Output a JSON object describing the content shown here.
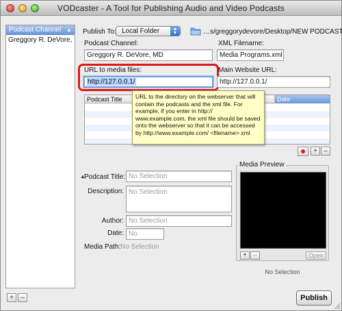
{
  "window": {
    "title": "VODcaster -  A Tool for Publishing Audio and Video Podcasts"
  },
  "sidebar": {
    "header": "Podcast Channel",
    "sort_glyph": "▲",
    "items": [
      "Greggory R. DeVore, MD"
    ],
    "add_label": "+",
    "remove_label": "–"
  },
  "publish_to": {
    "label": "Publish To:",
    "selected": "Local Folder",
    "path": "…s/greggorydevore/Desktop/NEW PODCAST"
  },
  "channel": {
    "podcast_channel_label": "Podcast Channel:",
    "podcast_channel_value": "Greggory R. DeVore, MD",
    "xml_filename_label": "XML Filename:",
    "xml_filename_value": "Media Programs.xml",
    "url_media_label": "URL to media files:",
    "url_media_value": "http://127.0.0.1/",
    "main_website_label": "Main Website URL:",
    "main_website_value": "http://127.0.0.1/"
  },
  "table": {
    "columns": [
      "Podcast Title",
      "Date"
    ]
  },
  "tooltip": {
    "text": "URL to the directory on the webserver that will contain the podcasts and the xml file.  For example, if you enter in http:// www.example.com, the xml file should be saved onto the webserver so that it can be accessed by http://www.example.com/ <filename>.xml"
  },
  "table_controls": {
    "add_label": "+",
    "remove_label": "–"
  },
  "episode": {
    "title_label": "Podcast Title:",
    "title_placeholder": "No Selection",
    "description_label": "Description:",
    "description_placeholder": "No Selection",
    "author_label": "Author:",
    "author_placeholder": "No Selection",
    "date_label": "Date:",
    "date_placeholder": "No",
    "media_path_label": "Media Path:",
    "media_path_value": "No Selection"
  },
  "media_preview": {
    "title": "Media Preview",
    "add_label": "+",
    "remove_label": "–",
    "open_label": "Open",
    "status": "No Selection"
  },
  "footer": {
    "publish_label": "Publish"
  },
  "colors": {
    "selection_blue": "#6c97d9",
    "highlight_red": "#e01616",
    "tooltip_bg": "#ffffc6"
  }
}
